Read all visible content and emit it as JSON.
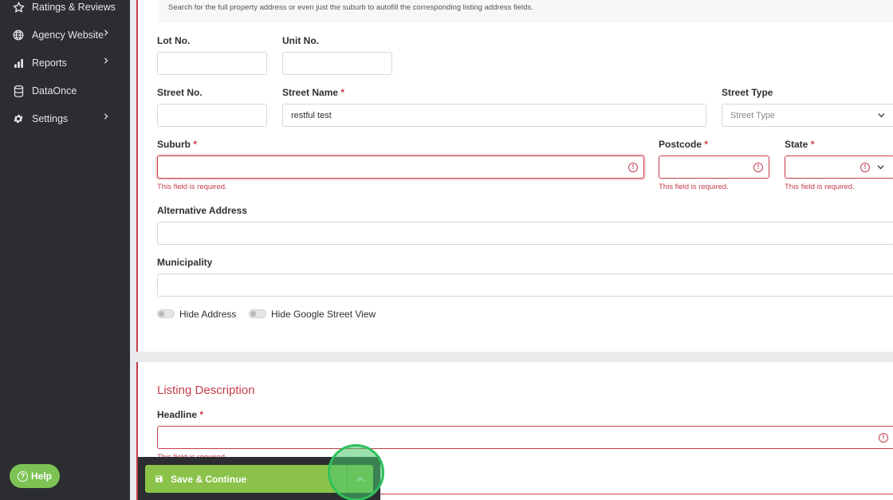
{
  "sidebar": {
    "items": [
      {
        "label": "Ratings & Reviews",
        "icon": "star-icon"
      },
      {
        "label": "Agency Website",
        "icon": "globe-icon"
      },
      {
        "label": "Reports",
        "icon": "bar-chart-icon"
      },
      {
        "label": "DataOnce",
        "icon": "database-icon"
      },
      {
        "label": "Settings",
        "icon": "gear-icon"
      }
    ],
    "help_label": "Help"
  },
  "address": {
    "hint": "Search for the full property address or even just the suburb to autofill the corresponding listing address fields.",
    "lot_no": {
      "label": "Lot No.",
      "value": ""
    },
    "unit_no": {
      "label": "Unit No.",
      "value": ""
    },
    "street_no": {
      "label": "Street No.",
      "value": ""
    },
    "street_name": {
      "label": "Street Name",
      "required": "*",
      "value": "restful test"
    },
    "street_type": {
      "label": "Street Type",
      "placeholder": "Street Type"
    },
    "suburb": {
      "label": "Suburb",
      "required": "*",
      "value": "",
      "error": "This field is required."
    },
    "postcode": {
      "label": "Postcode",
      "required": "*",
      "value": "",
      "error": "This field is required."
    },
    "state": {
      "label": "State",
      "required": "*",
      "value": "",
      "error": "This field is required."
    },
    "alternative_address": {
      "label": "Alternative Address",
      "value": ""
    },
    "municipality": {
      "label": "Municipality",
      "value": ""
    },
    "hide_address": {
      "label": "Hide Address",
      "enabled": false
    },
    "hide_street_view": {
      "label": "Hide Google Street View",
      "enabled": false
    }
  },
  "listing_description": {
    "title": "Listing Description",
    "headline": {
      "label": "Headline",
      "required": "*",
      "value": "",
      "error": "This field is required."
    }
  },
  "footer": {
    "save_label": "Save & Continue"
  },
  "colors": {
    "accent_red": "#c43d4b",
    "save_green": "#8bc34a",
    "sidebar_bg": "#2b2d31",
    "highlight_ring": "#2fc05b"
  }
}
